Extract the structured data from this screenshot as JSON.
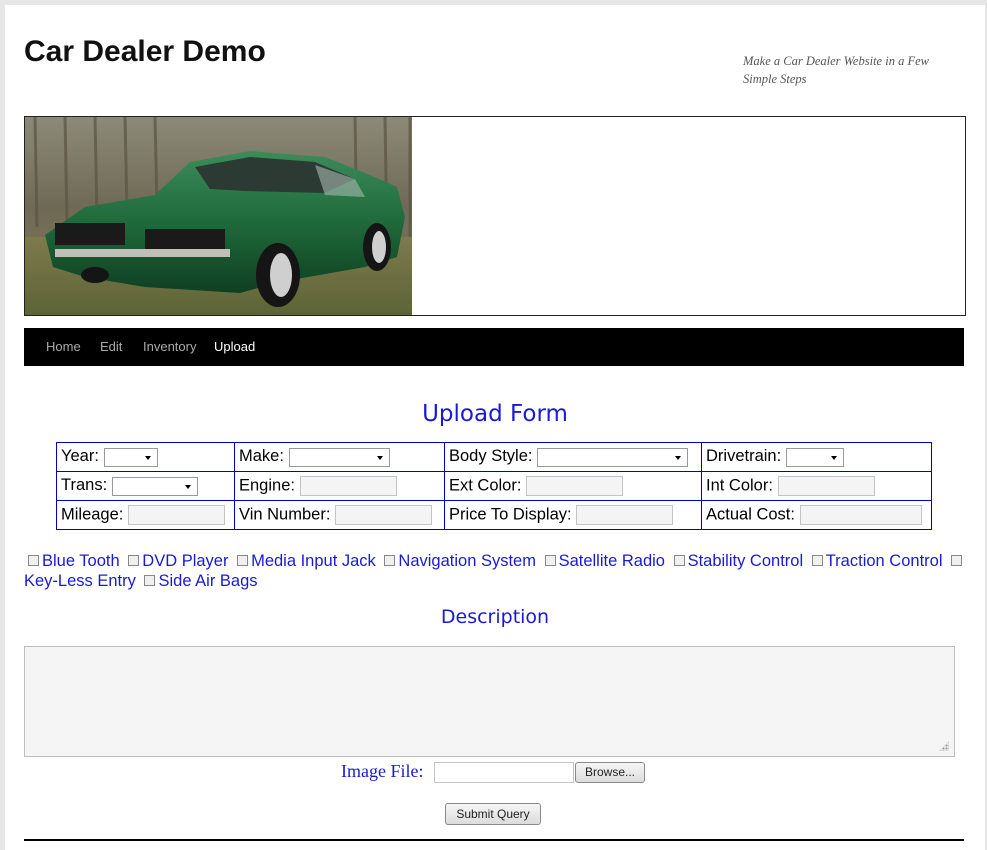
{
  "site": {
    "title": "Car Dealer Demo",
    "tagline": "Make a Car Dealer Website in a Few Simple Steps"
  },
  "nav": {
    "items": [
      {
        "label": "Home",
        "current": false
      },
      {
        "label": "Edit",
        "current": false
      },
      {
        "label": "Inventory",
        "current": false
      },
      {
        "label": "Upload",
        "current": true
      }
    ]
  },
  "form": {
    "title": "Upload Form",
    "rows": [
      [
        {
          "label": "Year:",
          "control": "select",
          "value": ""
        },
        {
          "label": "Make:",
          "control": "select",
          "value": ""
        },
        {
          "label": "Body Style:",
          "control": "select",
          "value": ""
        },
        {
          "label": "Drivetrain:",
          "control": "select",
          "value": ""
        }
      ],
      [
        {
          "label": "Trans:",
          "control": "select",
          "value": ""
        },
        {
          "label": "Engine:",
          "control": "text",
          "value": ""
        },
        {
          "label": "Ext Color:",
          "control": "text",
          "value": ""
        },
        {
          "label": "Int Color:",
          "control": "text",
          "value": ""
        }
      ],
      [
        {
          "label": "Mileage:",
          "control": "text",
          "value": ""
        },
        {
          "label": "Vin Number:",
          "control": "text",
          "value": ""
        },
        {
          "label": "Price To Display:",
          "control": "text",
          "value": ""
        },
        {
          "label": "Actual Cost:",
          "control": "text",
          "value": ""
        }
      ]
    ],
    "features": [
      {
        "label": "Blue Tooth",
        "checked": false
      },
      {
        "label": "DVD Player",
        "checked": false
      },
      {
        "label": "Media Input Jack",
        "checked": false
      },
      {
        "label": "Navigation System",
        "checked": false
      },
      {
        "label": "Satellite Radio",
        "checked": false
      },
      {
        "label": "Stability Control",
        "checked": false
      },
      {
        "label": "Traction Control",
        "checked": false
      },
      {
        "label": "Key-Less Entry",
        "checked": false
      },
      {
        "label": "Side Air Bags",
        "checked": false
      }
    ],
    "description_title": "Description",
    "description_value": "",
    "image_file_label": "Image File:",
    "browse_label": "Browse...",
    "submit_label": "Submit Query"
  },
  "colors": {
    "accent": "#1a1ad4",
    "nav_bg": "#000000",
    "table_border": "#0000c0",
    "car_body": "#1f6a3a"
  }
}
